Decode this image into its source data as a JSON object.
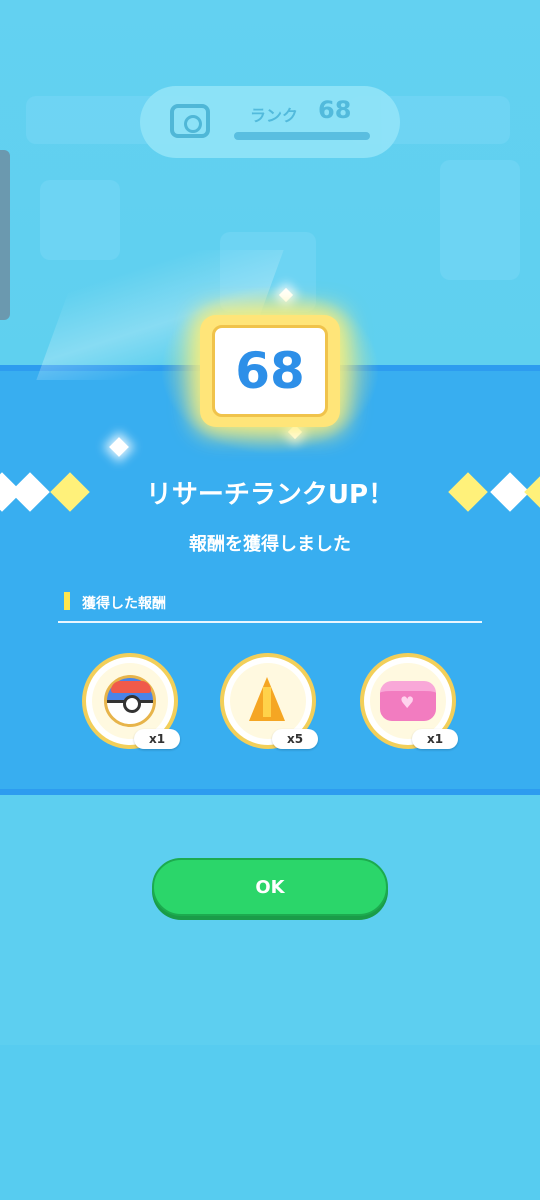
{
  "background": {
    "header_rank_label": "ランク",
    "header_rank_value": "68"
  },
  "rank_badge": {
    "value": "68"
  },
  "dialog": {
    "title": "リサーチランクUP！",
    "subtitle": "報酬を獲得しました",
    "section_label": "獲得した報酬",
    "rewards": [
      {
        "icon": "ball-icon",
        "count": "x1"
      },
      {
        "icon": "shard-icon",
        "count": "x5"
      },
      {
        "icon": "cake-icon",
        "count": "x1"
      }
    ]
  },
  "ok_button": {
    "label": "OK"
  },
  "colors": {
    "accent_blue": "#38aef0",
    "ok_green": "#2bd66a",
    "badge_yellow": "#ffe579"
  }
}
